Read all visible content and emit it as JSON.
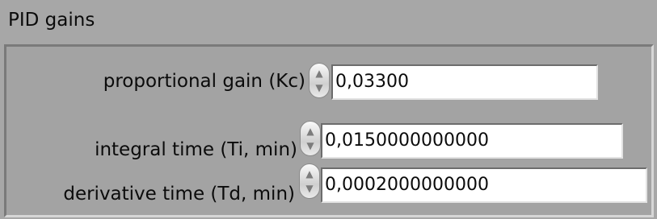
{
  "cluster": {
    "title": "PID gains",
    "controls": [
      {
        "label": "proportional gain (Kc)",
        "value": "0,03300"
      },
      {
        "label": "integral time (Ti, min)",
        "value": "0,0150000000000"
      },
      {
        "label": "derivative time (Td, min)",
        "value": "0,0002000000000"
      }
    ]
  },
  "icons": {
    "increment": "increment-arrow-icon",
    "decrement": "decrement-arrow-icon"
  },
  "colors": {
    "panel_background": "#a7a7a7",
    "field_background": "#ffffff",
    "text": "#0b0b0b"
  }
}
